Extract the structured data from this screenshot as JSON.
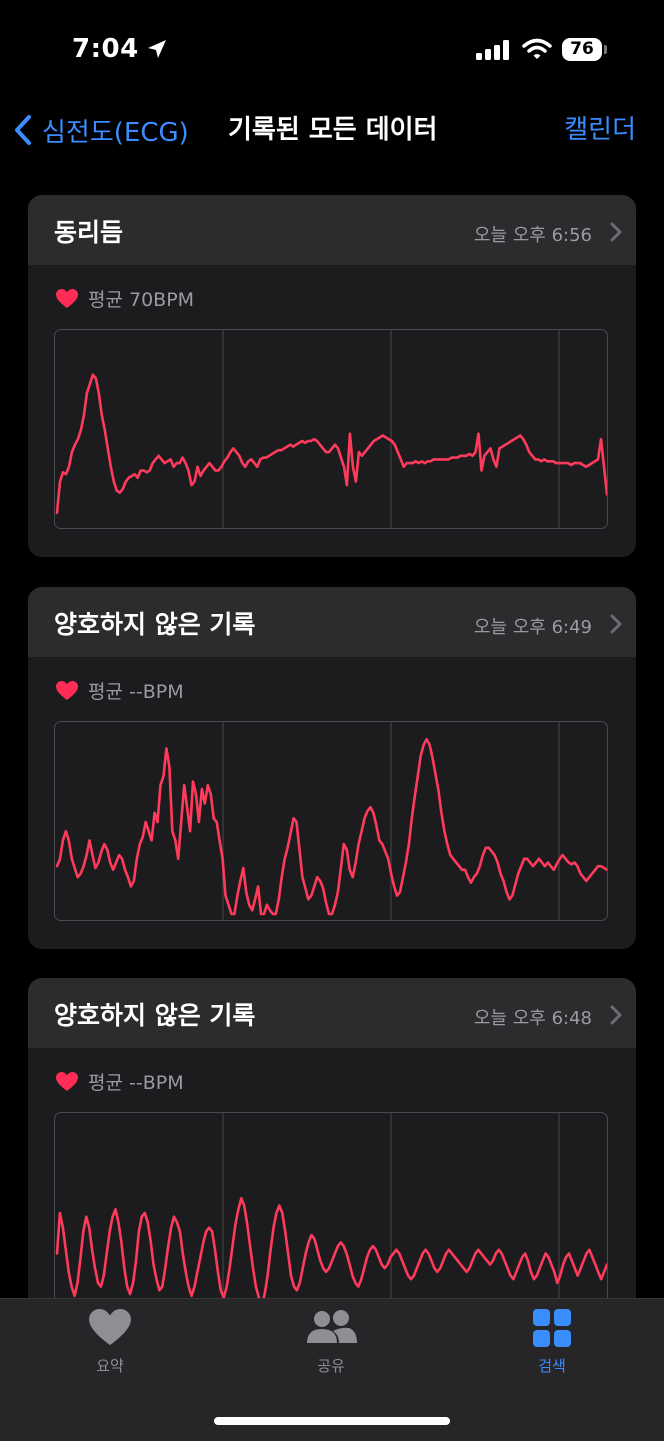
{
  "status": {
    "time": "7:04",
    "battery": "76"
  },
  "nav": {
    "back_label": "심전도(ECG)",
    "title": "기록된 모든 데이터",
    "right_label": "캘린더"
  },
  "colors": {
    "accent": "#3a8dff",
    "ecg": "#ff3b5c",
    "heart": "#ff2d55"
  },
  "records": [
    {
      "title": "동리듬",
      "time": "오늘 오후 6:56",
      "avg": "평균 70BPM",
      "trace": [
        0.95,
        0.78,
        0.73,
        0.74,
        0.7,
        0.62,
        0.58,
        0.55,
        0.5,
        0.42,
        0.3,
        0.25,
        0.2,
        0.22,
        0.3,
        0.42,
        0.5,
        0.6,
        0.7,
        0.78,
        0.83,
        0.84,
        0.82,
        0.78,
        0.76,
        0.75,
        0.74,
        0.76,
        0.72,
        0.72,
        0.73,
        0.72,
        0.68,
        0.66,
        0.64,
        0.66,
        0.68,
        0.67,
        0.66,
        0.7,
        0.68,
        0.68,
        0.65,
        0.68,
        0.72,
        0.8,
        0.78,
        0.7,
        0.75,
        0.72,
        0.7,
        0.68,
        0.7,
        0.72,
        0.72,
        0.7,
        0.67,
        0.65,
        0.62,
        0.6,
        0.62,
        0.64,
        0.68,
        0.7,
        0.67,
        0.66,
        0.68,
        0.7,
        0.66,
        0.65,
        0.65,
        0.64,
        0.63,
        0.62,
        0.61,
        0.61,
        0.6,
        0.59,
        0.58,
        0.59,
        0.58,
        0.57,
        0.56,
        0.57,
        0.56,
        0.56,
        0.55,
        0.56,
        0.58,
        0.6,
        0.62,
        0.62,
        0.6,
        0.58,
        0.6,
        0.65,
        0.7,
        0.8,
        0.52,
        0.7,
        0.78,
        0.62,
        0.64,
        0.62,
        0.6,
        0.58,
        0.56,
        0.55,
        0.54,
        0.53,
        0.54,
        0.55,
        0.56,
        0.58,
        0.62,
        0.66,
        0.7,
        0.68,
        0.68,
        0.68,
        0.67,
        0.68,
        0.67,
        0.68,
        0.67,
        0.67,
        0.66,
        0.66,
        0.66,
        0.66,
        0.66,
        0.66,
        0.65,
        0.65,
        0.65,
        0.64,
        0.64,
        0.64,
        0.63,
        0.64,
        0.62,
        0.52,
        0.72,
        0.64,
        0.62,
        0.6,
        0.66,
        0.7,
        0.6,
        0.59,
        0.58,
        0.57,
        0.56,
        0.55,
        0.54,
        0.53,
        0.55,
        0.58,
        0.62,
        0.64,
        0.66,
        0.66,
        0.67,
        0.66,
        0.67,
        0.67,
        0.67,
        0.68,
        0.68,
        0.68,
        0.68,
        0.68,
        0.69,
        0.68,
        0.68,
        0.68,
        0.69,
        0.7,
        0.69,
        0.68,
        0.67,
        0.66,
        0.55,
        0.7,
        0.85
      ]
    },
    {
      "title": "양호하지 않은 기록",
      "time": "오늘 오후 6:49",
      "avg": "평균 --BPM",
      "trace": [
        0.74,
        0.7,
        0.6,
        0.55,
        0.6,
        0.7,
        0.75,
        0.8,
        0.78,
        0.74,
        0.68,
        0.6,
        0.68,
        0.75,
        0.72,
        0.66,
        0.62,
        0.65,
        0.72,
        0.76,
        0.72,
        0.68,
        0.7,
        0.76,
        0.8,
        0.85,
        0.82,
        0.7,
        0.62,
        0.58,
        0.5,
        0.55,
        0.6,
        0.45,
        0.5,
        0.3,
        0.25,
        0.1,
        0.2,
        0.55,
        0.6,
        0.7,
        0.5,
        0.3,
        0.42,
        0.55,
        0.28,
        0.35,
        0.5,
        0.32,
        0.4,
        0.3,
        0.35,
        0.48,
        0.5,
        0.6,
        0.7,
        0.9,
        0.95,
        1.0,
        1.0,
        0.9,
        0.82,
        0.75,
        0.88,
        0.95,
        0.98,
        0.92,
        0.85,
        1.0,
        1.0,
        0.95,
        0.98,
        1.0,
        1.0,
        0.92,
        0.8,
        0.7,
        0.64,
        0.56,
        0.48,
        0.5,
        0.65,
        0.8,
        0.86,
        0.92,
        0.9,
        0.85,
        0.8,
        0.82,
        0.86,
        0.94,
        1.0,
        1.0,
        0.95,
        0.88,
        0.75,
        0.62,
        0.65,
        0.76,
        0.8,
        0.72,
        0.62,
        0.55,
        0.48,
        0.44,
        0.42,
        0.45,
        0.52,
        0.6,
        0.62,
        0.66,
        0.7,
        0.78,
        0.85,
        0.9,
        0.88,
        0.8,
        0.72,
        0.62,
        0.48,
        0.36,
        0.25,
        0.14,
        0.08,
        0.05,
        0.08,
        0.15,
        0.24,
        0.33,
        0.45,
        0.55,
        0.62,
        0.68,
        0.7,
        0.72,
        0.74,
        0.76,
        0.76,
        0.8,
        0.83,
        0.8,
        0.78,
        0.74,
        0.68,
        0.64,
        0.64,
        0.66,
        0.68,
        0.72,
        0.78,
        0.82,
        0.88,
        0.92,
        0.9,
        0.84,
        0.78,
        0.74,
        0.7,
        0.7,
        0.72,
        0.74,
        0.72,
        0.7,
        0.72,
        0.74,
        0.72,
        0.74,
        0.76,
        0.73,
        0.7,
        0.68,
        0.7,
        0.72,
        0.73,
        0.72,
        0.74,
        0.78,
        0.8,
        0.82,
        0.8,
        0.78,
        0.76,
        0.74,
        0.74,
        0.75,
        0.76
      ]
    },
    {
      "title": "양호하지 않은 기록",
      "time": "오늘 오후 6:48",
      "avg": "평균 --BPM",
      "trace": [
        0.72,
        0.5,
        0.58,
        0.7,
        0.82,
        0.9,
        0.95,
        0.88,
        0.75,
        0.6,
        0.52,
        0.58,
        0.7,
        0.8,
        0.88,
        0.9,
        0.84,
        0.72,
        0.6,
        0.52,
        0.48,
        0.55,
        0.66,
        0.8,
        0.9,
        0.94,
        0.88,
        0.76,
        0.6,
        0.52,
        0.5,
        0.55,
        0.65,
        0.78,
        0.86,
        0.92,
        0.9,
        0.8,
        0.68,
        0.58,
        0.52,
        0.55,
        0.6,
        0.72,
        0.82,
        0.9,
        0.95,
        0.9,
        0.82,
        0.74,
        0.66,
        0.6,
        0.58,
        0.6,
        0.7,
        0.82,
        0.92,
        0.96,
        0.9,
        0.8,
        0.68,
        0.56,
        0.48,
        0.42,
        0.46,
        0.56,
        0.68,
        0.8,
        0.9,
        0.96,
        1.0,
        0.94,
        0.84,
        0.7,
        0.58,
        0.5,
        0.46,
        0.5,
        0.6,
        0.72,
        0.84,
        0.9,
        0.92,
        0.88,
        0.8,
        0.72,
        0.66,
        0.62,
        0.64,
        0.7,
        0.76,
        0.8,
        0.82,
        0.8,
        0.76,
        0.72,
        0.68,
        0.66,
        0.68,
        0.72,
        0.78,
        0.84,
        0.88,
        0.9,
        0.86,
        0.8,
        0.74,
        0.7,
        0.68,
        0.7,
        0.74,
        0.78,
        0.8,
        0.78,
        0.74,
        0.72,
        0.7,
        0.72,
        0.76,
        0.8,
        0.84,
        0.86,
        0.84,
        0.8,
        0.76,
        0.72,
        0.7,
        0.72,
        0.76,
        0.8,
        0.82,
        0.8,
        0.76,
        0.72,
        0.7,
        0.72,
        0.74,
        0.76,
        0.78,
        0.8,
        0.82,
        0.8,
        0.76,
        0.72,
        0.7,
        0.72,
        0.74,
        0.76,
        0.78,
        0.76,
        0.72,
        0.7,
        0.72,
        0.76,
        0.8,
        0.84,
        0.86,
        0.82,
        0.78,
        0.74,
        0.72,
        0.76,
        0.82,
        0.86,
        0.84,
        0.8,
        0.76,
        0.72,
        0.74,
        0.78,
        0.82,
        0.88,
        0.84,
        0.78,
        0.74,
        0.72,
        0.76,
        0.8,
        0.84,
        0.8,
        0.76,
        0.72,
        0.7,
        0.74,
        0.78,
        0.82,
        0.86,
        0.82,
        0.78
      ]
    }
  ],
  "tabs": [
    {
      "label": "요약"
    },
    {
      "label": "공유"
    },
    {
      "label": "검색"
    }
  ]
}
